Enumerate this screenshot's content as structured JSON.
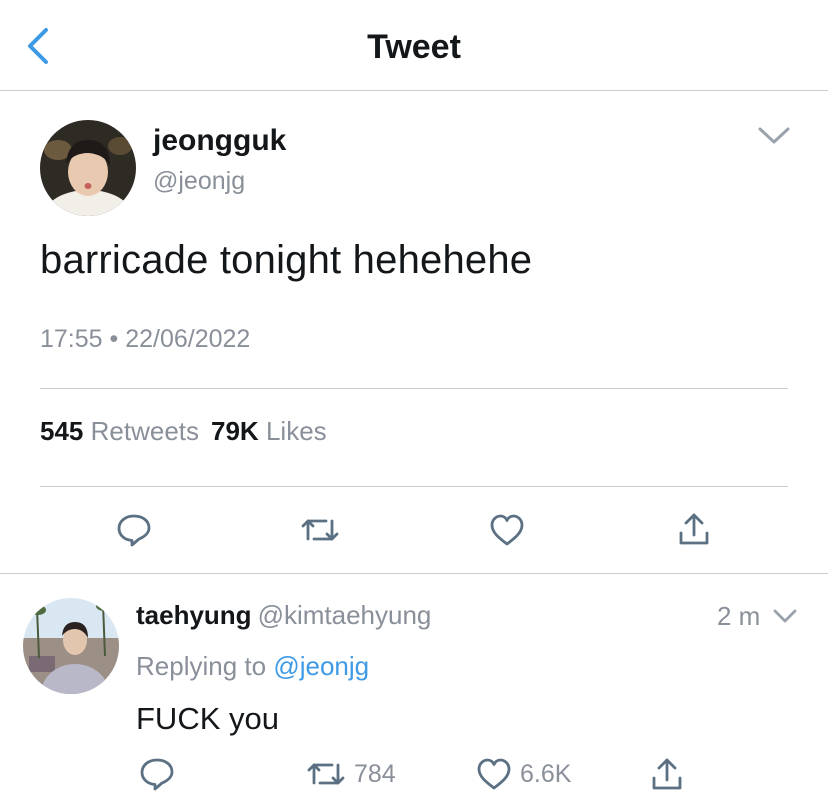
{
  "header": {
    "title": "Tweet",
    "back_icon": "chevron-left-icon"
  },
  "tweet": {
    "display_name": "jeongguk",
    "handle": "@jeonjg",
    "text": "barricade tonight hehehehe",
    "timestamp": "17:55 • 22/06/2022",
    "retweets_count": "545",
    "retweets_label": "Retweets",
    "likes_count": "79K",
    "likes_label": "Likes",
    "actions": [
      "reply-icon",
      "retweet-icon",
      "like-icon",
      "share-icon"
    ]
  },
  "reply": {
    "display_name": "taehyung",
    "handle": "@kimtaehyung",
    "time": "2 m",
    "replying_prefix": "Replying to",
    "replying_to": "@jeonjg",
    "text": "FUCK you",
    "retweets_count": "784",
    "likes_count": "6.6K"
  },
  "colors": {
    "accent": "#3f9ae6",
    "secondary_text": "#8a9099",
    "icon": "#5b7083",
    "divider": "#c9ccd0"
  }
}
